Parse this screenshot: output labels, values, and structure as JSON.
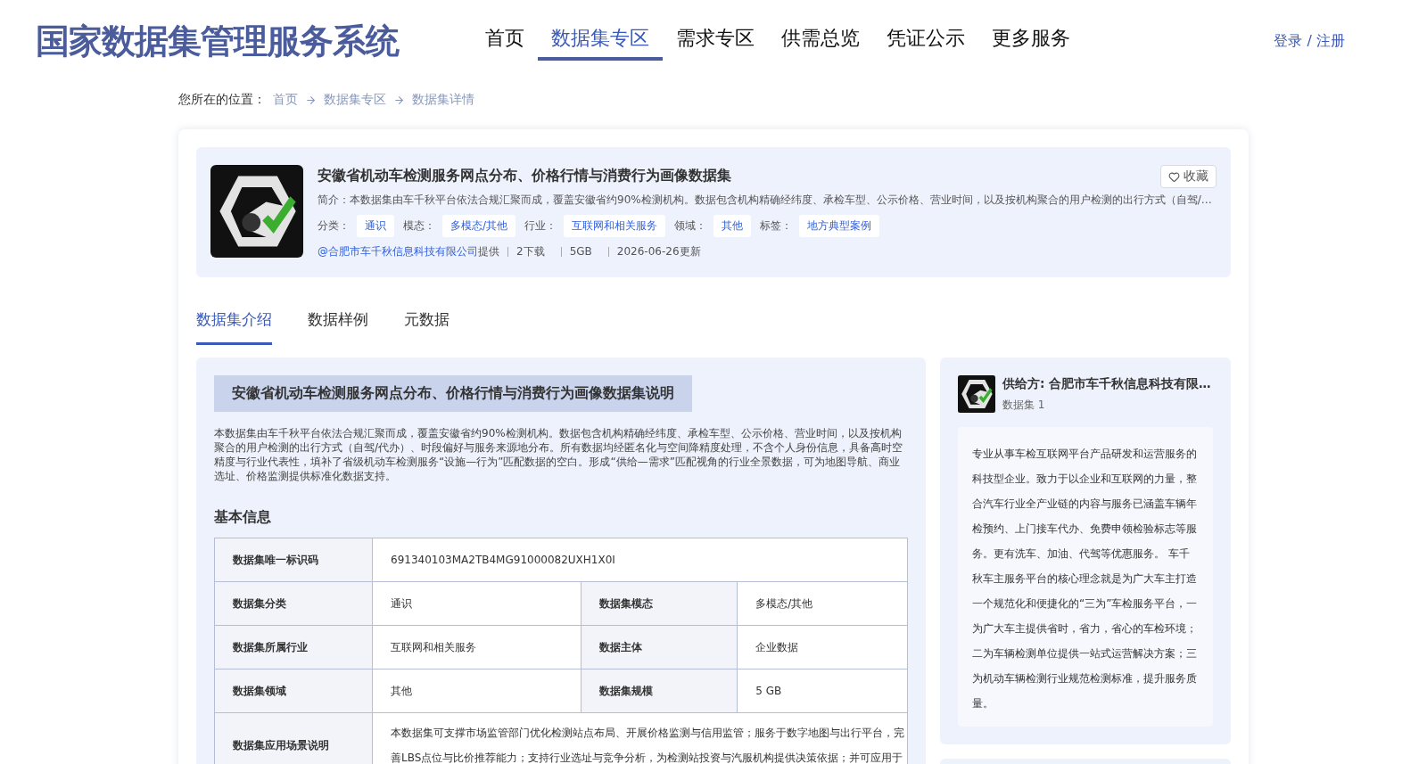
{
  "header": {
    "logo_text": "国家数据集管理服务系统",
    "nav": [
      {
        "label": "首页",
        "selected": false
      },
      {
        "label": "数据集专区",
        "selected": true
      },
      {
        "label": "需求专区",
        "selected": false
      },
      {
        "label": "供需总览",
        "selected": false
      },
      {
        "label": "凭证公示",
        "selected": false
      },
      {
        "label": "更多服务",
        "selected": false
      }
    ],
    "auth": "登录 / 注册"
  },
  "breadcrumb": {
    "prefix": "您所在的位置：",
    "items": [
      "首页",
      "数据集专区",
      "数据集详情"
    ]
  },
  "dataset": {
    "title": "安徽省机动车检测服务网点分布、价格行情与消费行为画像数据集",
    "favorite": "收藏",
    "summary": "简介：本数据集由车千秋平台依法合规汇聚而成，覆盖安徽省约90%检测机构。数据包含机构精确经纬度、承检车型、公示价格、营业时间，以及按机构聚合的用户检测的出行方式（自驾/…",
    "tags": [
      {
        "label": "分类：",
        "value": "通识"
      },
      {
        "label": "模态：",
        "value": "多模态/其他"
      },
      {
        "label": "行业：",
        "value": "互联网和相关服务"
      },
      {
        "label": "领域：",
        "value": "其他"
      },
      {
        "label": "标签：",
        "value": "地方典型案例"
      }
    ],
    "provider": "@合肥市车千秋信息科技有限公司",
    "provider_suffix": "提供",
    "stats": [
      "2下载",
      "5GB",
      "2026-06-26更新"
    ]
  },
  "tabs": [
    {
      "label": "数据集介绍",
      "selected": true
    },
    {
      "label": "数据样例",
      "selected": false
    },
    {
      "label": "元数据",
      "selected": false
    }
  ],
  "description": {
    "title": "安徽省机动车检测服务网点分布、价格行情与消费行为画像数据集说明",
    "body": "本数据集由车千秋平台依法合规汇聚而成，覆盖安徽省约90%检测机构。数据包含机构精确经纬度、承检车型、公示价格、营业时间，以及按机构聚合的用户检测的出行方式（自驾/代办）、时段偏好与服务来源地分布。所有数据均经匿名化与空间降精度处理，不含个人身份信息，具备高时空精度与行业代表性，填补了省级机动车检测服务“设施—行为”匹配数据的空白。形成“供给—需求”匹配视角的行业全景数据，可为地图导航、商业选址、价格监测提供标准化数据支持。"
  },
  "basic_info": {
    "title": "基本信息",
    "rows": [
      [
        {
          "label": "数据集唯一标识码",
          "value": "691340103MA2TB4MG91000082UXH1X0I"
        }
      ],
      [
        {
          "label": "数据集分类",
          "value": "通识"
        },
        {
          "label": "数据集模态",
          "value": "多模态/其他"
        }
      ],
      [
        {
          "label": "数据集所属行业",
          "value": "互联网和相关服务"
        },
        {
          "label": "数据主体",
          "value": "企业数据"
        }
      ],
      [
        {
          "label": "数据集领域",
          "value": "其他"
        },
        {
          "label": "数据集规模",
          "value": "5 GB"
        }
      ],
      [
        {
          "label": "数据集应用场景说明",
          "value": "本数据集可支撑市场监管部门优化检测站点布局、开展价格监测与信用监管；服务于数字地图与出行平台，完善LBS点位与比价推荐能力；支持行业选址与竞争分析，为检测站投资与汽服机构提供决策依据；并可应用于"
        }
      ]
    ]
  },
  "supplier": {
    "name": "供给方: 合肥市车千秋信息科技有限…",
    "count": "数据集 1",
    "bio": "专业从事车检互联网平台产品研发和运营服务的科技型企业。致力于以企业和互联网的力量，整合汽车行业全产业链的内容与服务已涵盖车辆年检预约、上门接车代办、免费申领检验标志等服务。更有洗车、加油、代驾等优惠服务。 车千秋车主服务平台的核心理念就是为广大车主打造一个规范化和便捷化的“三为”车检服务平台，一为广大车主提供省时，省力，省心的车检环境；二为车辆检测单位提供一站式运营解决方案；三为机动车辆检测行业规范检测标准，提升服务质量。"
  }
}
